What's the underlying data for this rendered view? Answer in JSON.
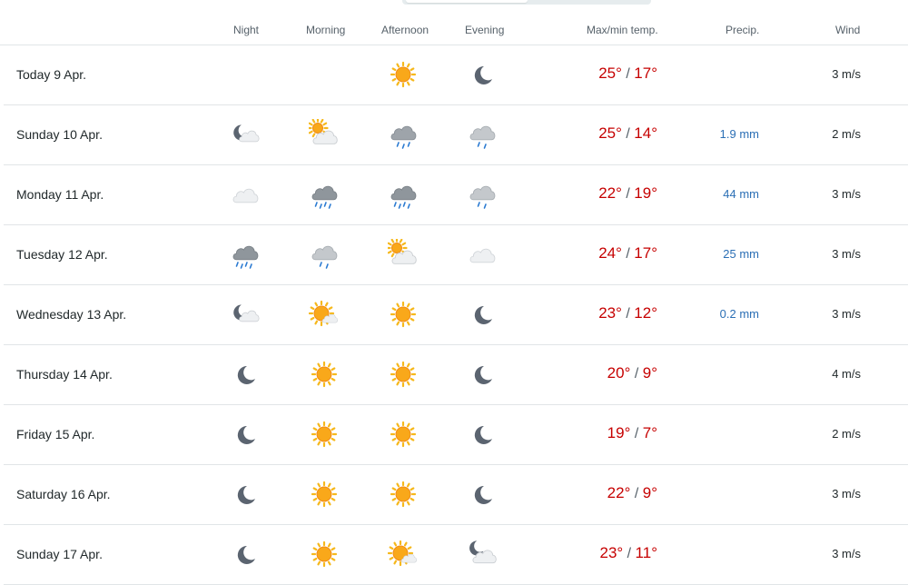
{
  "columns": {
    "night": "Night",
    "morning": "Morning",
    "afternoon": "Afternoon",
    "evening": "Evening",
    "temp": "Max/min temp.",
    "precip": "Precip.",
    "wind": "Wind"
  },
  "colors": {
    "max_temp": "#c60000",
    "precip": "#2b6fb5",
    "separator": "#e1e5e7"
  },
  "rows": [
    {
      "date": "Today 9 Apr.",
      "icons": [
        "",
        "",
        "sun-icon",
        "moon-icon"
      ],
      "max": "25°",
      "min": "17°",
      "precip": "",
      "wind": "3 m/s"
    },
    {
      "date": "Sunday 10 Apr.",
      "icons": [
        "moon-cloud-icon",
        "sun-cloud-icon",
        "rain-cloud-icon",
        "light-rain-cloud-icon"
      ],
      "max": "25°",
      "min": "14°",
      "precip": "1.9 mm",
      "wind": "2 m/s"
    },
    {
      "date": "Monday 11 Apr.",
      "icons": [
        "cloud-icon",
        "heavy-rain-cloud-icon",
        "heavy-rain-cloud-icon",
        "light-rain-cloud-icon"
      ],
      "max": "22°",
      "min": "19°",
      "precip": "44 mm",
      "wind": "3 m/s"
    },
    {
      "date": "Tuesday 12 Apr.",
      "icons": [
        "heavy-rain-cloud-icon",
        "light-rain-cloud-icon",
        "sun-cloud-icon",
        "cloud-icon"
      ],
      "max": "24°",
      "min": "17°",
      "precip": "25 mm",
      "wind": "3 m/s"
    },
    {
      "date": "Wednesday 13 Apr.",
      "icons": [
        "moon-cloud-icon",
        "sun-small-cloud-icon",
        "sun-icon",
        "moon-icon"
      ],
      "max": "23°",
      "min": "12°",
      "precip": "0.2 mm",
      "wind": "3 m/s"
    },
    {
      "date": "Thursday 14 Apr.",
      "icons": [
        "moon-icon",
        "sun-icon",
        "sun-icon",
        "moon-icon"
      ],
      "max": "20°",
      "min": "9°",
      "precip": "",
      "wind": "4 m/s"
    },
    {
      "date": "Friday 15 Apr.",
      "icons": [
        "moon-icon",
        "sun-icon",
        "sun-icon",
        "moon-icon"
      ],
      "max": "19°",
      "min": "7°",
      "precip": "",
      "wind": "2 m/s"
    },
    {
      "date": "Saturday 16 Apr.",
      "icons": [
        "moon-icon",
        "sun-icon",
        "sun-icon",
        "moon-icon"
      ],
      "max": "22°",
      "min": "9°",
      "precip": "",
      "wind": "3 m/s"
    },
    {
      "date": "Sunday 17 Apr.",
      "icons": [
        "moon-icon",
        "sun-icon",
        "sun-small-cloud-icon",
        "moon-cloud-large-icon"
      ],
      "max": "23°",
      "min": "11°",
      "precip": "",
      "wind": "3 m/s"
    }
  ]
}
